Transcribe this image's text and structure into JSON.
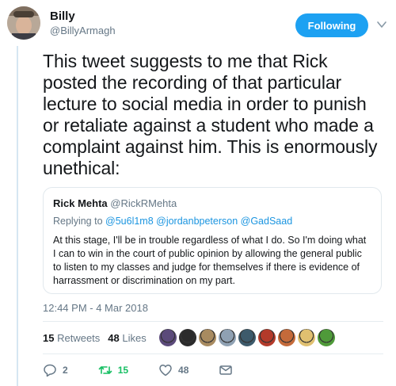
{
  "author": {
    "name": "Billy",
    "handle": "@BillyArmagh"
  },
  "follow_button": {
    "label": "Following"
  },
  "tweet": {
    "text": "This tweet suggests to me that Rick posted the recording of that particular lecture to social media in order to punish or retaliate against a student who made a complaint against him. This is enormously unethical:",
    "timestamp": "12:44 PM - 4 Mar 2018"
  },
  "quoted_tweet": {
    "name": "Rick Mehta",
    "handle": "@RickRMehta",
    "replying_prefix": "Replying to",
    "mentions": "@5u6l1m8 @jordanbpeterson @GadSaad",
    "text": "At this stage, I'll be in trouble regardless of what I do. So I'm doing what I can to win in the court of public opinion by allowing the general public to listen to my classes and judge for themselves if there is evidence of harrassment or discrimination on my part."
  },
  "stats": {
    "retweets_count": "15",
    "retweets_label": "Retweets",
    "likes_count": "48",
    "likes_label": "Likes"
  },
  "liker_avatar_colors": [
    "#5b4a7a",
    "#2b2b2b",
    "#a88b60",
    "#8fa1b3",
    "#3d5a6b",
    "#b33a2a",
    "#c46a3a",
    "#e0c070",
    "#4f9a3a"
  ],
  "actions": {
    "replies": "2",
    "retweets": "15",
    "likes": "48"
  },
  "colors": {
    "accent": "#1da1f2",
    "retweet_green": "#17bf63",
    "muted": "#657786",
    "link": "#1b95e0"
  }
}
